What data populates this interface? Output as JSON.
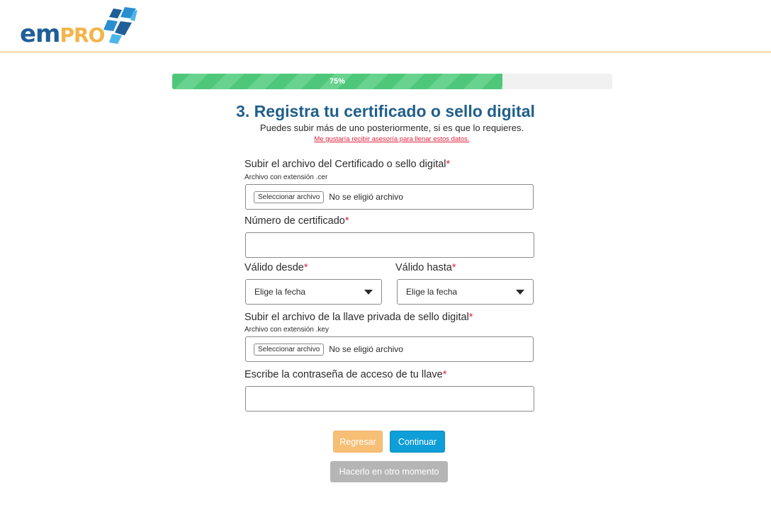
{
  "header": {
    "logo_em": "em",
    "logo_pro": "PRO",
    "brand_colors": {
      "primary": "#1f5f98",
      "accent": "#f3b44a"
    }
  },
  "progress": {
    "value_percent": 75,
    "label": "75%",
    "fill_color": "#4fc77a"
  },
  "page": {
    "title": "3. Registra tu certificado o sello digital",
    "subtitle": "Puedes subir más de uno posteriormente, si es que lo requieres.",
    "help_link": "Me gustaría recibir asesoría para llenar estos datos."
  },
  "form": {
    "certificate_file": {
      "label": "Subir el archivo del Certificado o sello digital",
      "required_mark": "*",
      "hint": "Archivo con extensión .cer",
      "button": "Seleccionar archivo",
      "status": "No se eligió archivo"
    },
    "certificate_number": {
      "label": "Número de certificado",
      "required_mark": "*",
      "value": ""
    },
    "valid_from": {
      "label": "Válido desde",
      "required_mark": "*",
      "placeholder": "Elige la fecha"
    },
    "valid_to": {
      "label": "Válido hasta",
      "required_mark": "*",
      "placeholder": "Elige la fecha"
    },
    "key_file": {
      "label": "Subir el archivo de la llave privada de sello digital",
      "required_mark": "*",
      "hint": "Archivo con extensión .key",
      "button": "Seleccionar archivo",
      "status": "No se eligió archivo"
    },
    "key_password": {
      "label": "Escribe la contraseña de acceso de tu llave",
      "required_mark": "*",
      "value": ""
    }
  },
  "actions": {
    "back": "Regresar",
    "continue": "Continuar",
    "later": "Hacerlo en otro momento"
  }
}
